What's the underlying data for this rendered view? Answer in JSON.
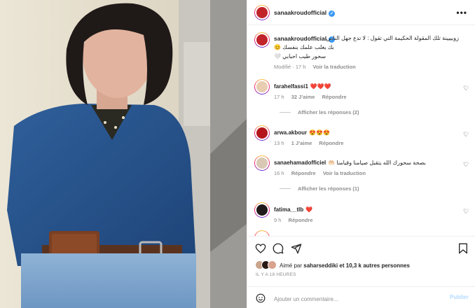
{
  "header": {
    "username": "sanaakroudofficial",
    "verified": "✓",
    "more": "•••"
  },
  "caption": {
    "username": "sanaakroudofficial",
    "line1": "زوبييينة تلك المقولة الحكيمة التي تقول : لا تدع جهل الناس",
    "line2": "بك يغلب علمك بنفسك 😊",
    "line3": "سحور طيب احبابي 🤍",
    "edited": "Modifié · 17 h",
    "translate": "Voir la traduction"
  },
  "comments": [
    {
      "username": "farahelfassi1",
      "text": "❤️❤️❤️",
      "age": "17 h",
      "likes": "32 J’aime",
      "reply": "Répondre",
      "toggle": "Afficher les réponses (2)"
    },
    {
      "username": "arwa.akbour",
      "text": "😍😍😍",
      "age": "13 h",
      "likes": "1 J’aime",
      "reply": "Répondre"
    },
    {
      "username": "sanaehamadofficiel",
      "text": "بصحة سحورك الله يتقبل صيامنا وقيامنا 🤲🏻",
      "age": "16 h",
      "reply": "Répondre",
      "translate": "Voir la traduction",
      "toggle": "Afficher les réponses (1)"
    },
    {
      "username": "fatima__tlb",
      "text": "❤️",
      "age": "9 h",
      "reply": "Répondre"
    }
  ],
  "actions": {
    "liked_by_prefix": "Aimé par",
    "liked_by_user": "saharseddiki",
    "liked_by_suffix": "et 10,3 k autres personnes",
    "time": "IL Y A 18 HEURES"
  },
  "composer": {
    "placeholder": "Ajouter un commentaire...",
    "post_label": "Publier"
  },
  "colors": {
    "verified": "#3897f0",
    "post_button": "#b3dbff",
    "muted": "#8e8e8e"
  }
}
